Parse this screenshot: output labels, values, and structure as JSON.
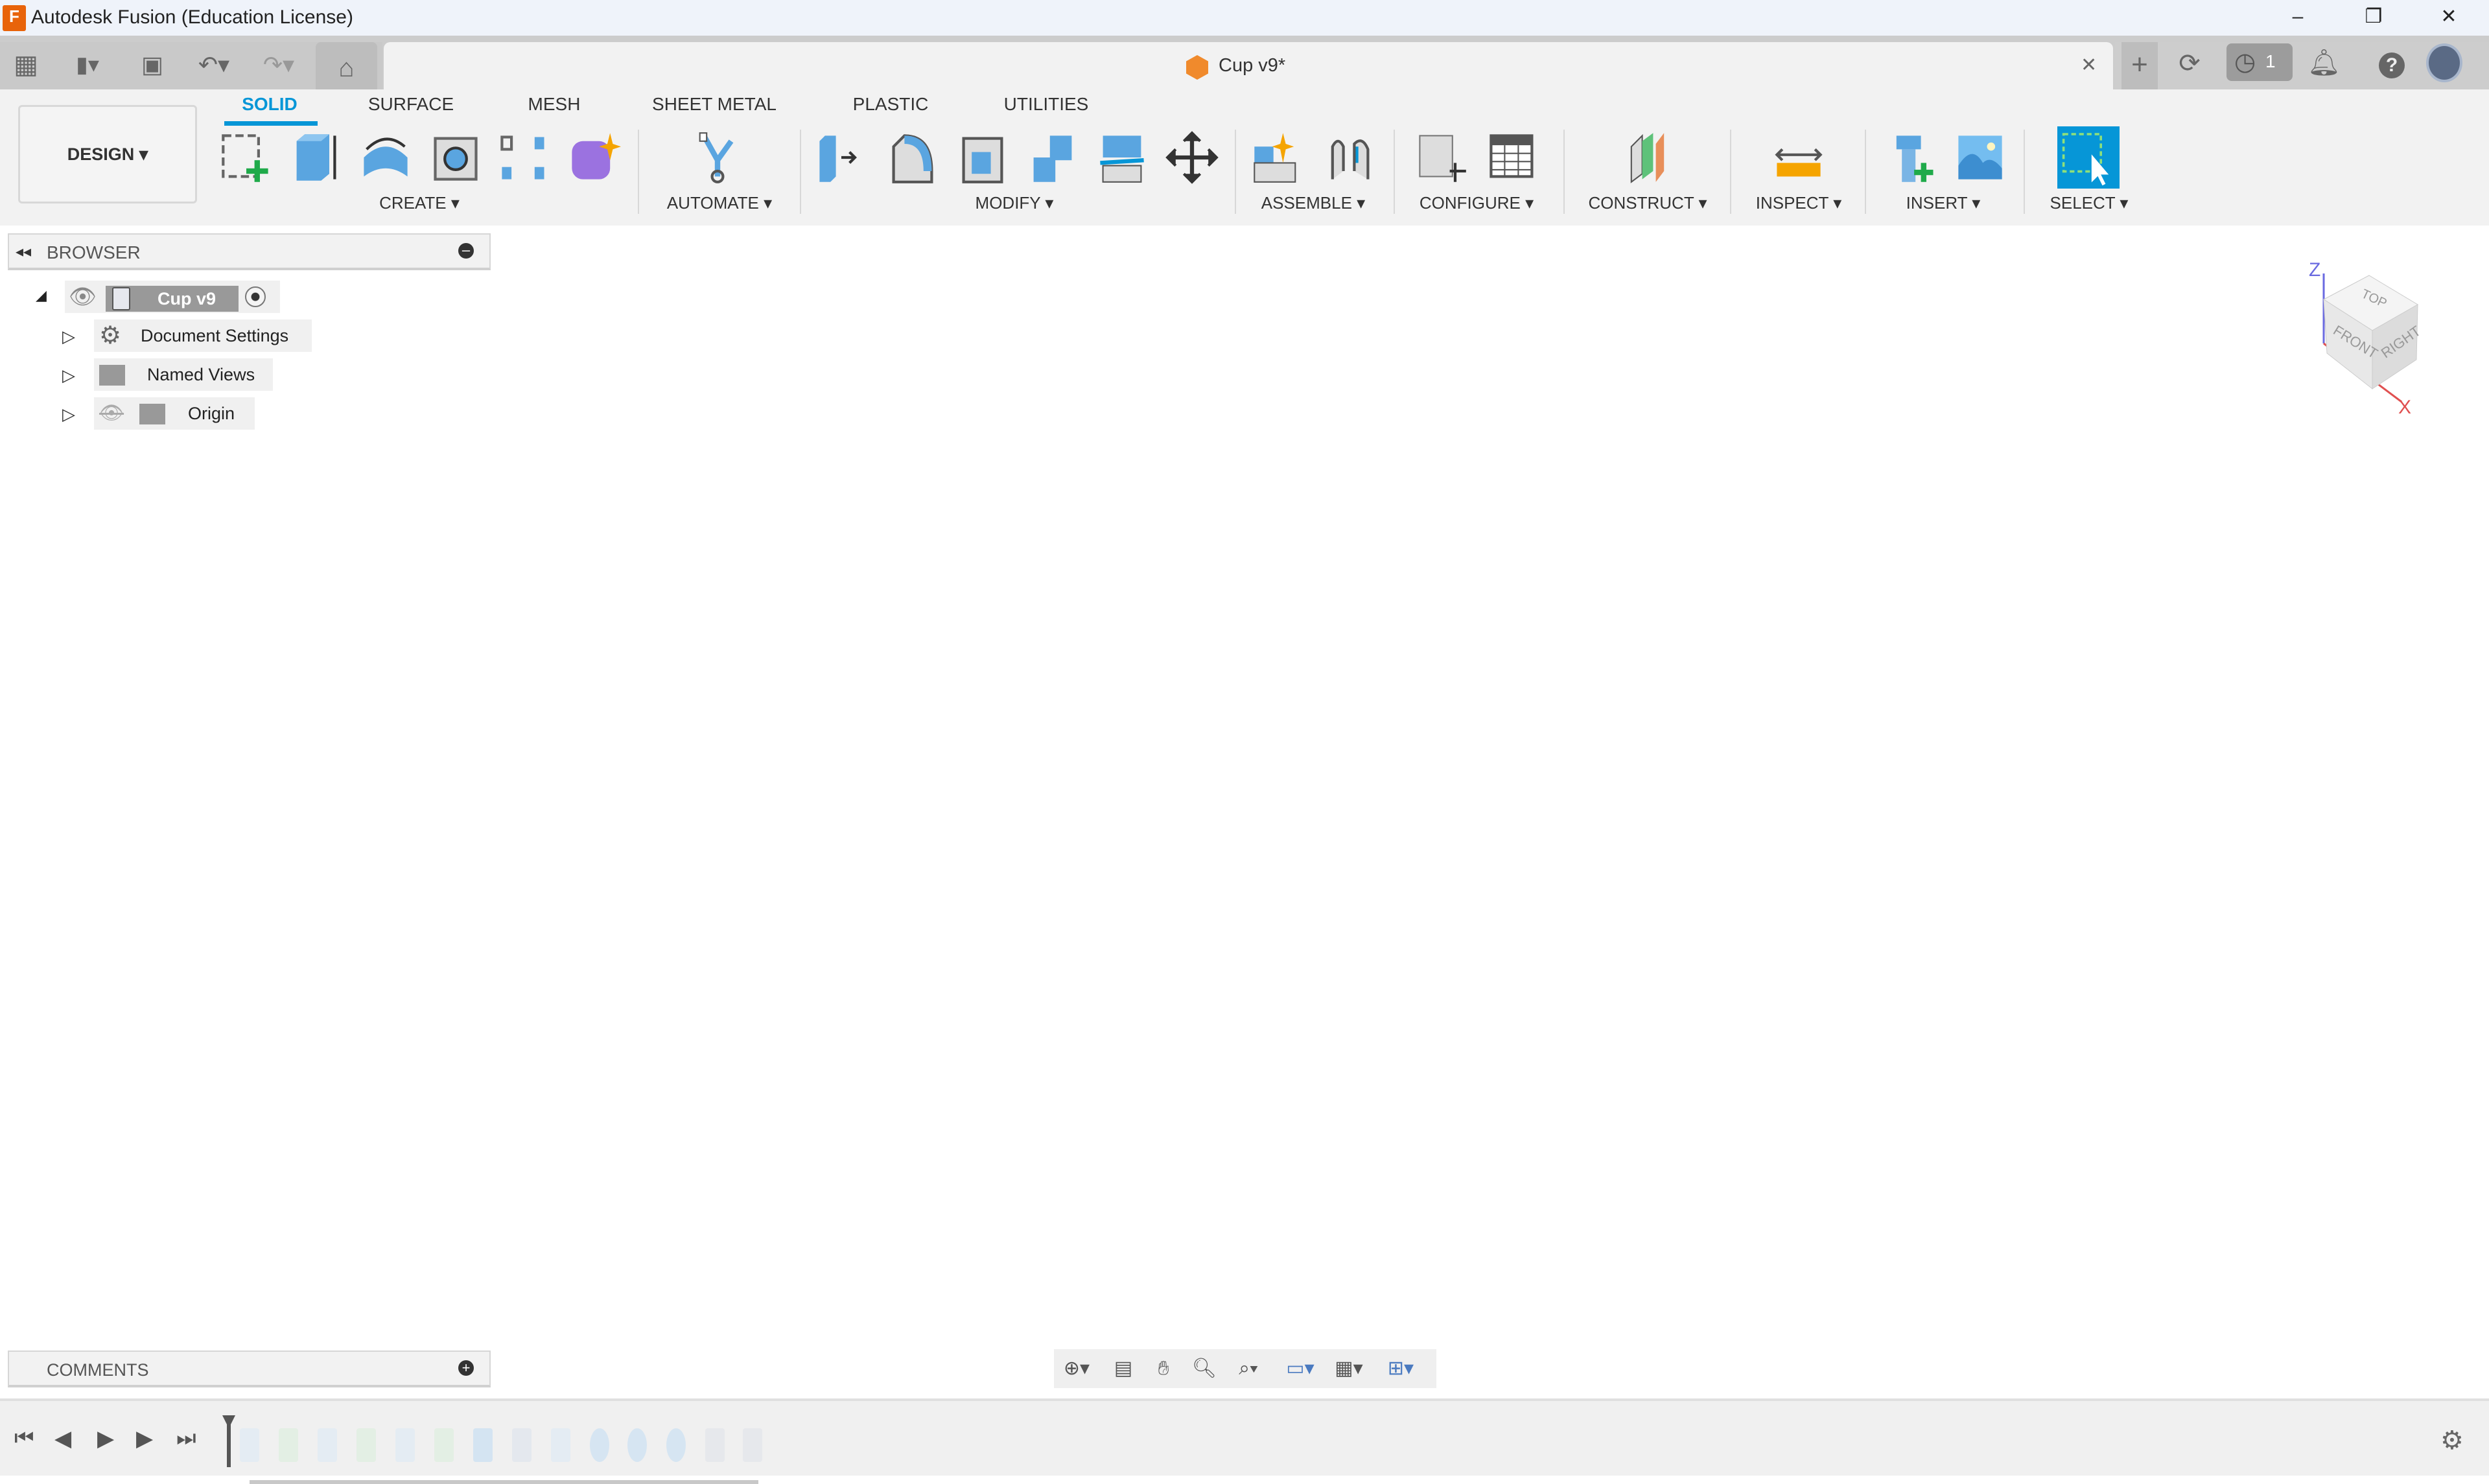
{
  "window": {
    "title": "Autodesk Fusion (Education License)",
    "minimize": "–",
    "restore": "❐",
    "close": "✕"
  },
  "document_tab": {
    "name": "Cup v9*",
    "close": "✕"
  },
  "quick_access": {
    "icons": [
      "apps-grid-icon",
      "file-icon",
      "save-icon",
      "undo-icon",
      "redo-icon",
      "home-icon"
    ]
  },
  "top_right": {
    "jobs_count": "1",
    "icons": [
      "new-tab-icon",
      "sync-icon",
      "job-status-icon",
      "notifications-icon",
      "help-icon",
      "avatar"
    ]
  },
  "workspace": {
    "label": "DESIGN ▾"
  },
  "tabs": [
    {
      "label": "SOLID",
      "active": true
    },
    {
      "label": "SURFACE"
    },
    {
      "label": "MESH"
    },
    {
      "label": "SHEET METAL"
    },
    {
      "label": "PLASTIC"
    },
    {
      "label": "UTILITIES"
    }
  ],
  "groups": {
    "create": "CREATE ▾",
    "automate": "AUTOMATE ▾",
    "modify": "MODIFY ▾",
    "assemble": "ASSEMBLE ▾",
    "configure": "CONFIGURE ▾",
    "construct": "CONSTRUCT ▾",
    "inspect": "INSPECT ▾",
    "insert": "INSERT ▾",
    "select": "SELECT ▾"
  },
  "colors": {
    "accent": "#0696d7",
    "toolbar_bg": "#f2f2f2",
    "title_bg": "#eff3fa"
  },
  "browser": {
    "label": "BROWSER",
    "root": "Cup v9",
    "items": [
      "Document Settings",
      "Named Views",
      "Origin"
    ]
  },
  "comments": {
    "label": "COMMENTS"
  },
  "viewcube": {
    "top": "TOP",
    "front": "FRONT",
    "right": "RIGHT",
    "z": "Z",
    "x": "X"
  }
}
